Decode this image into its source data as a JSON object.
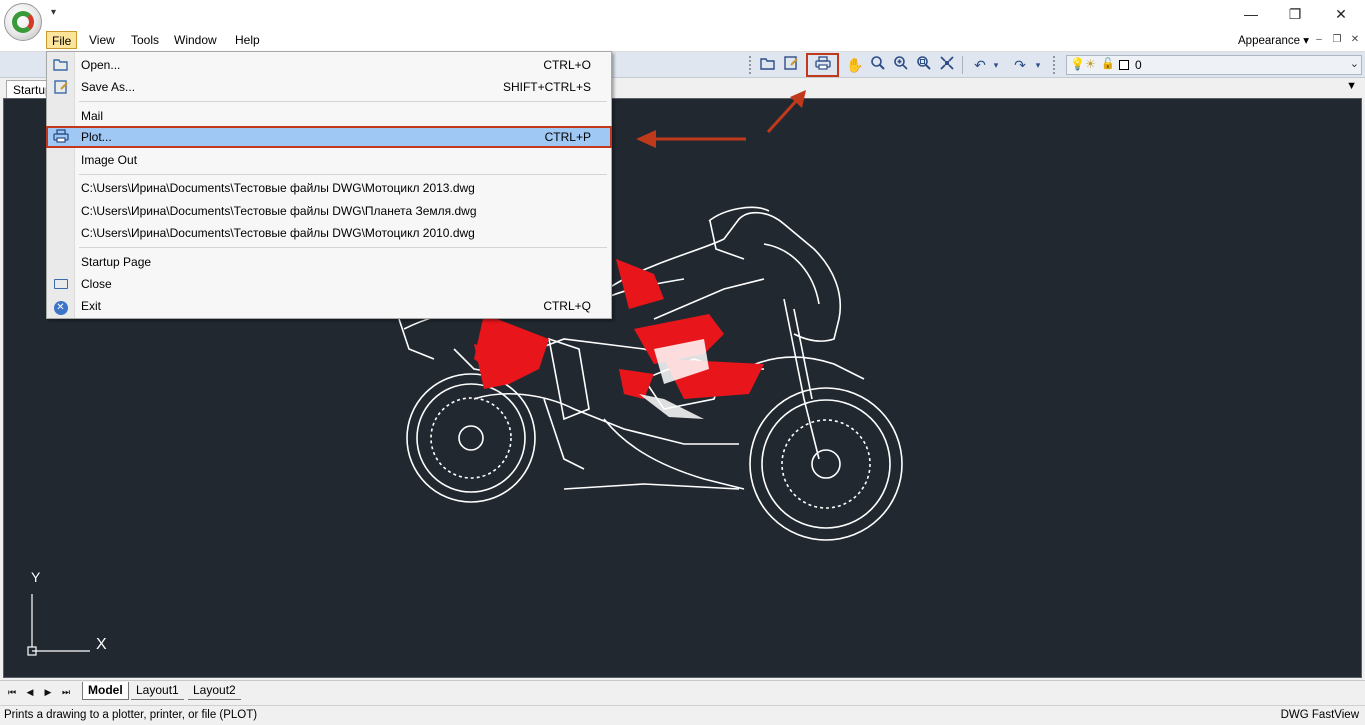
{
  "window": {
    "quick_access": "▾",
    "minimize": "—",
    "maximize": "❐",
    "close": "✕"
  },
  "menubar": {
    "items": [
      "File",
      "View",
      "Tools",
      "Window",
      "Help"
    ],
    "appearance": "Appearance ▾",
    "mini_controls": [
      "–",
      "❐",
      "✕"
    ]
  },
  "doc_tab": {
    "label": "Startup",
    "dropdown": "▼"
  },
  "toolbar": {
    "layer_value": "0"
  },
  "file_menu": {
    "items": [
      {
        "icon": "open-folder-icon",
        "label": "Open...",
        "shortcut": "CTRL+O"
      },
      {
        "icon": "save-as-icon",
        "label": "Save As...",
        "shortcut": "SHIFT+CTRL+S"
      },
      {
        "icon": "",
        "label": "Mail",
        "shortcut": ""
      },
      {
        "icon": "printer-icon",
        "label": "Plot...",
        "shortcut": "CTRL+P"
      },
      {
        "icon": "",
        "label": "Image Out",
        "shortcut": ""
      },
      {
        "icon": "",
        "label": "C:\\Users\\Ирина\\Documents\\Тестовые файлы DWG\\Мотоцикл 2013.dwg",
        "shortcut": ""
      },
      {
        "icon": "",
        "label": "C:\\Users\\Ирина\\Documents\\Тестовые файлы DWG\\Планета Земля.dwg",
        "shortcut": ""
      },
      {
        "icon": "",
        "label": "C:\\Users\\Ирина\\Documents\\Тестовые файлы DWG\\Мотоцикл 2010.dwg",
        "shortcut": ""
      },
      {
        "icon": "",
        "label": "Startup Page",
        "shortcut": ""
      },
      {
        "icon": "close-folder-icon",
        "label": "Close",
        "shortcut": ""
      },
      {
        "icon": "exit-icon",
        "label": "Exit",
        "shortcut": "CTRL+Q"
      }
    ]
  },
  "ucs": {
    "y_label": "Y",
    "x_label": "X"
  },
  "layout_tabs": {
    "nav": [
      "⏮",
      "◀",
      "▶",
      "⏭"
    ],
    "tabs": [
      "Model",
      "Layout1",
      "Layout2"
    ]
  },
  "status": {
    "text": "Prints a drawing to a plotter, printer, or file (PLOT)",
    "app_name": "DWG FastView"
  },
  "colors": {
    "canvas_bg": "#212830",
    "accent_red": "#c0391b",
    "menu_highlight": "#9fc8f4",
    "drawing_red": "#e8161b"
  }
}
